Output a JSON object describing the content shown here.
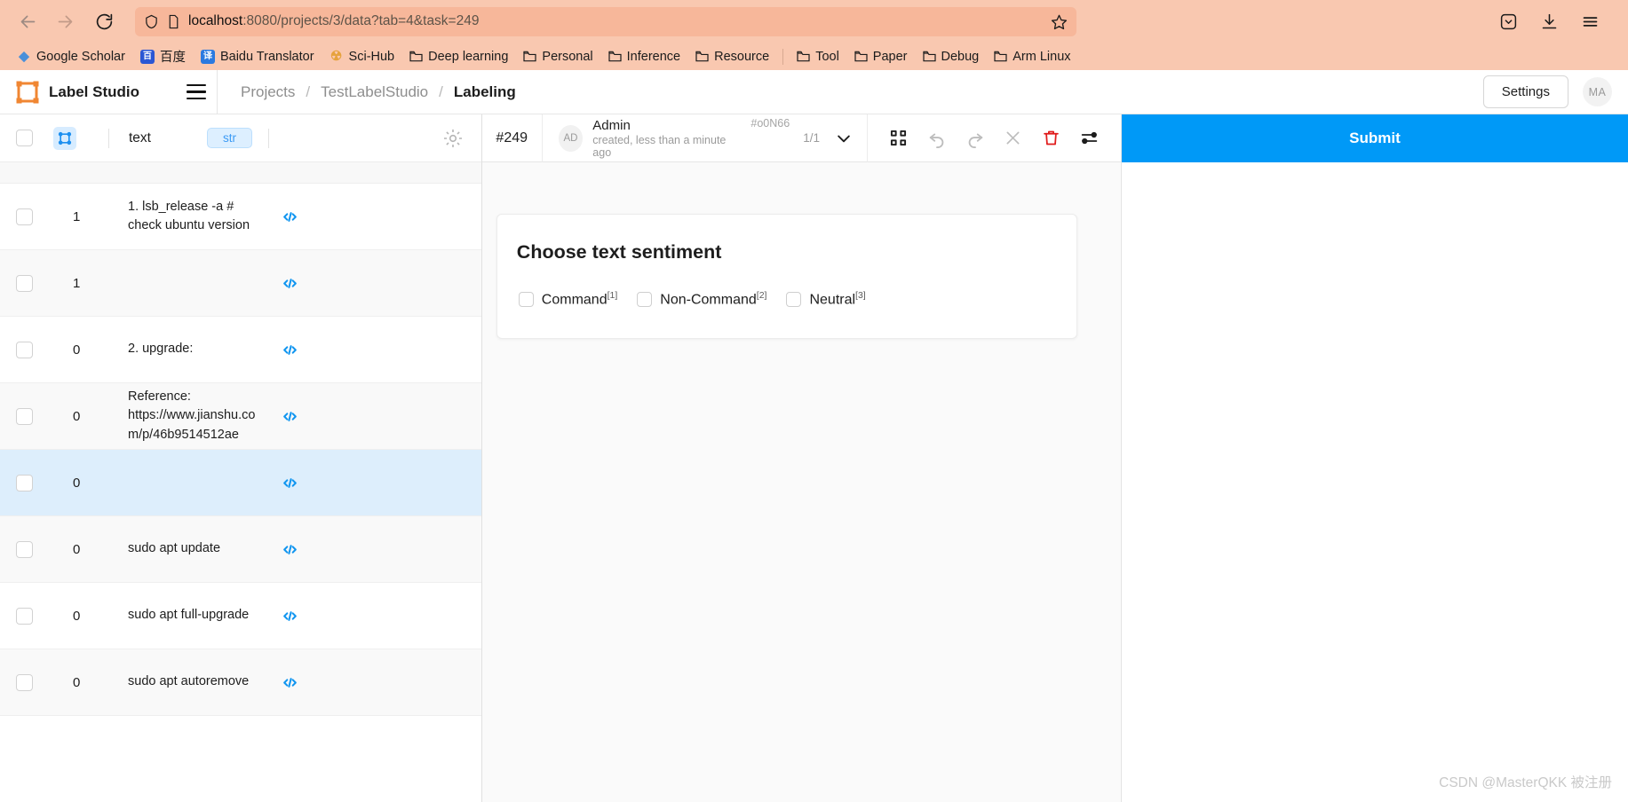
{
  "browser": {
    "back_icon": "back-arrow-icon",
    "forward_icon": "forward-arrow-icon",
    "reload_icon": "reload-icon",
    "url_host": "localhost",
    "url_path": ":8080/projects/3/data?tab=4&task=249",
    "url_full": "localhost:8080/projects/3/data?tab=4&task=249",
    "shield_icon": "shield-icon",
    "page-icon": "page-icon",
    "star_icon": "star-icon",
    "pocket_icon": "pocket-icon",
    "download_icon": "download-icon",
    "menu_icon": "hamburger-menu-icon",
    "bookmarks": [
      {
        "label": "Google Scholar",
        "type": "favicon",
        "glyph": "◆",
        "color": "#4a90d9"
      },
      {
        "label": "百度",
        "type": "favicon",
        "glyph": "百",
        "color": "#2b57d4"
      },
      {
        "label": "Baidu Translator",
        "type": "favicon",
        "glyph": "译",
        "color": "#2b7ae0"
      },
      {
        "label": "Sci-Hub",
        "type": "favicon",
        "glyph": "☢",
        "color": "#e6a23c"
      },
      {
        "label": "Deep learning",
        "type": "folder"
      },
      {
        "label": "Personal",
        "type": "folder"
      },
      {
        "label": "Inference",
        "type": "folder"
      },
      {
        "label": "Resource",
        "type": "folder"
      },
      {
        "label": "__SEP__",
        "type": "separator"
      },
      {
        "label": "Tool",
        "type": "folder"
      },
      {
        "label": "Paper",
        "type": "folder"
      },
      {
        "label": "Debug",
        "type": "folder"
      },
      {
        "label": "Arm Linux",
        "type": "folder"
      }
    ]
  },
  "app": {
    "brand": "Label Studio",
    "logo_icon": "label-studio-logo-icon",
    "menu_icon": "hamburger-menu-icon",
    "breadcrumb": [
      {
        "label": "Projects",
        "current": false
      },
      {
        "label": "TestLabelStudio",
        "current": false
      },
      {
        "label": "Labeling",
        "current": true
      }
    ],
    "breadcrumb_separator": "/",
    "settings_label": "Settings",
    "avatar_initials": "MA"
  },
  "table": {
    "header": {
      "select_all_checkbox": "",
      "annotations_icon": "annotations-icon",
      "column_label": "text",
      "type_badge": "str",
      "gear_icon": "settings-gear-icon"
    },
    "rows": [
      {
        "count": "1",
        "text": "1. lsb_release -a # check ubuntu version",
        "code_icon": "code-icon",
        "selected": false
      },
      {
        "count": "1",
        "text": "",
        "code_icon": "code-icon",
        "selected": false
      },
      {
        "count": "0",
        "text": "2. upgrade:",
        "code_icon": "code-icon",
        "selected": false
      },
      {
        "count": "0",
        "text": "Reference: https://www.jianshu.com/p/46b9514512ae",
        "code_icon": "code-icon",
        "selected": false
      },
      {
        "count": "0",
        "text": "",
        "code_icon": "code-icon",
        "selected": true
      },
      {
        "count": "0",
        "text": "sudo apt update",
        "code_icon": "code-icon",
        "selected": false
      },
      {
        "count": "0",
        "text": "sudo apt full-upgrade",
        "code_icon": "code-icon",
        "selected": false
      },
      {
        "count": "0",
        "text": "sudo apt autoremove",
        "code_icon": "code-icon",
        "selected": false
      }
    ]
  },
  "task": {
    "id": "#249",
    "annotator_initials": "AD",
    "annotator_name": "Admin",
    "annotator_sub": "created, less than a minute ago",
    "annotation_hash": "#o0N66",
    "pager": "1/1",
    "chevron_icon": "chevron-down-icon",
    "tools": [
      {
        "name": "grid-view-icon",
        "tone": "dark"
      },
      {
        "name": "undo-icon",
        "tone": "muted"
      },
      {
        "name": "redo-icon",
        "tone": "muted"
      },
      {
        "name": "reset-close-icon",
        "tone": "muted"
      },
      {
        "name": "trash-icon",
        "tone": "danger"
      },
      {
        "name": "settings-sliders-icon",
        "tone": "dark"
      }
    ]
  },
  "labeling": {
    "title": "Choose text sentiment",
    "choices": [
      {
        "label": "Command",
        "hotkey": "[1]",
        "checked": false
      },
      {
        "label": "Non-Command",
        "hotkey": "[2]",
        "checked": false
      },
      {
        "label": "Neutral",
        "hotkey": "[3]",
        "checked": false
      }
    ]
  },
  "submit": {
    "label": "Submit"
  },
  "watermark": "CSDN @MasterQKK 被注册",
  "colors": {
    "browser_chrome": "#f9c8b0",
    "url_bar": "#f7b79a",
    "accent_blue": "#0099f7",
    "code_icon_blue": "#1296f0",
    "selected_row": "#ddeefc",
    "danger_red": "#e01b1b",
    "badge_blue": "#3d9bf5"
  }
}
